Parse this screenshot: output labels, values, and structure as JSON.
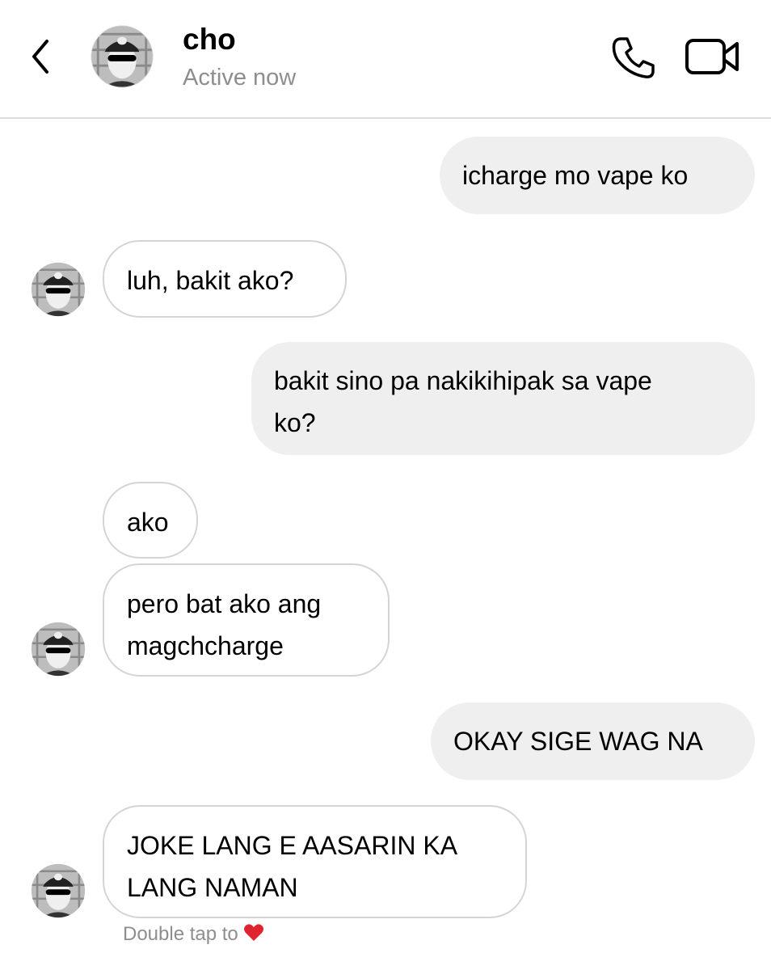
{
  "header": {
    "name": "cho",
    "status": "Active now",
    "icons": {
      "back": "chevron-left-icon",
      "call": "phone-icon",
      "video": "video-camera-icon"
    }
  },
  "messages": [
    {
      "from": "me",
      "text": "icharge mo vape ko"
    },
    {
      "from": "them",
      "text": "luh, bakit ako?"
    },
    {
      "from": "me",
      "text": "bakit sino pa nakikihipak sa vape\nko?"
    },
    {
      "from": "them",
      "text": "ako"
    },
    {
      "from": "them",
      "text": "pero bat ako ang\nmagchcharge"
    },
    {
      "from": "me",
      "text": "OKAY SIGE WAG NA"
    },
    {
      "from": "them",
      "text": "JOKE LANG E AASARIN KA\nLANG NAMAN"
    }
  ],
  "footer": {
    "hint": "Double tap to",
    "heart_color": "#e0242f"
  },
  "colors": {
    "outgoing_bubble": "#efefef",
    "incoming_border": "#d4d4d4",
    "secondary_text": "#8e8e8e"
  }
}
